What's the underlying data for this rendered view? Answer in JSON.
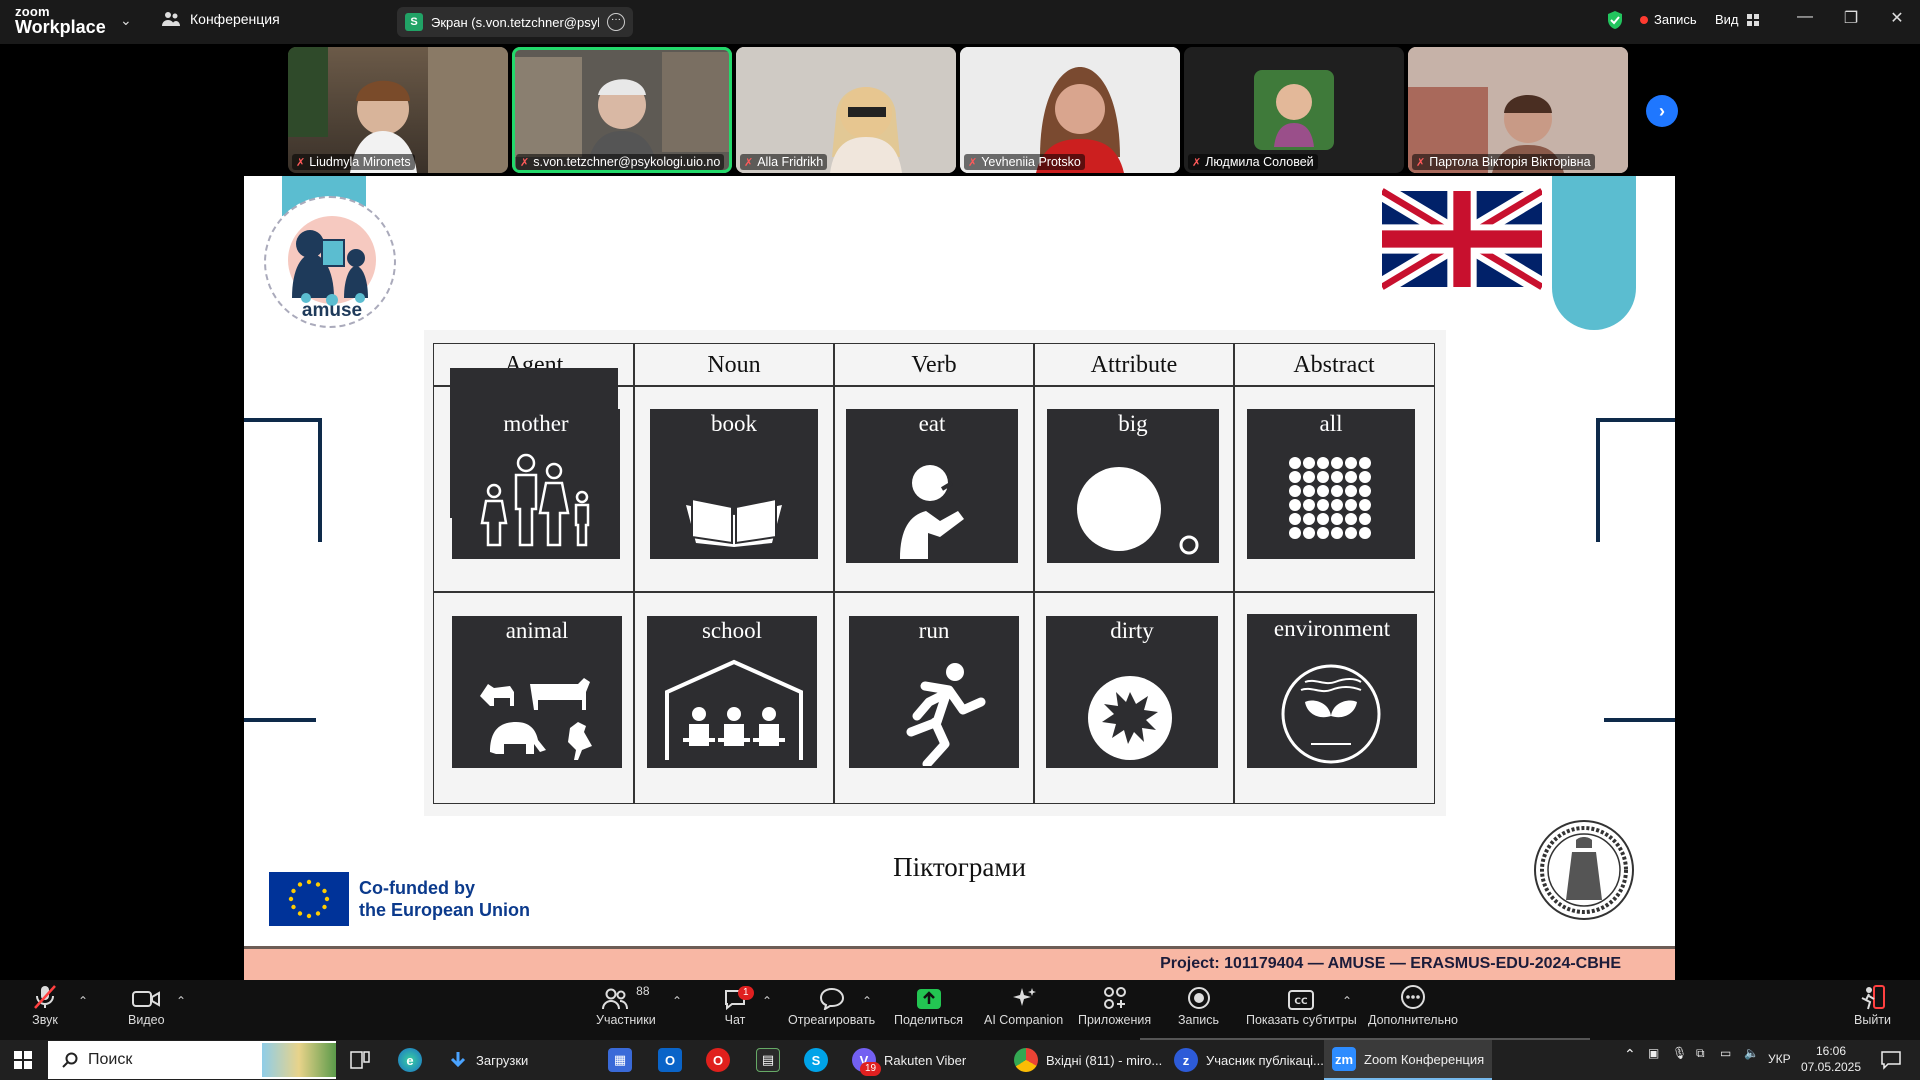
{
  "titlebar": {
    "brand_line1": "zoom",
    "brand_line2": "Workplace",
    "meeting_label": "Конференция",
    "share_badge": "S",
    "share_text": "Экран (s.von.tetzchner@psykolo",
    "record_label": "Запись",
    "view_label": "Вид",
    "colors": {
      "bar": "#1a1a1a",
      "shield": "#22c55e",
      "record": "#ff3b30"
    }
  },
  "participants": [
    {
      "name": "Liudmyla Mironets",
      "active": false
    },
    {
      "name": "s.von.tetzchner@psykologi.uio.no",
      "active": true
    },
    {
      "name": "Alla Fridrikh",
      "active": false
    },
    {
      "name": "Yevheniia Protsko",
      "active": false
    },
    {
      "name": "Людмила Соловей",
      "active": false
    },
    {
      "name": "Партола Вікторія Вікторівна",
      "active": false
    }
  ],
  "slide": {
    "logo_text": "amuse",
    "headers": [
      "Agent",
      "Noun",
      "Verb",
      "Attribute",
      "Abstract"
    ],
    "row1": [
      "mother",
      "book",
      "eat",
      "big",
      "all"
    ],
    "row2": [
      "animal",
      "school",
      "run",
      "dirty",
      "environment"
    ],
    "caption": "Піктограми",
    "eu_line1": "Co-funded by",
    "eu_line2": "the European Union",
    "project": "Project: 101179404 — AMUSE — ERASMUS-EDU-2024-CBHE",
    "colors": {
      "accent": "#5bbdd0",
      "navy": "#0e2a4a",
      "project_bar": "#f8b7a4",
      "eu_blue": "#003399"
    }
  },
  "toolbar": {
    "audio": "Звук",
    "video": "Видео",
    "participants": "Участники",
    "participants_count": "88",
    "chat": "Чат",
    "chat_badge": "1",
    "react": "Отреагировать",
    "share": "Поделиться",
    "ai": "AI Companion",
    "apps": "Приложения",
    "record": "Запись",
    "captions": "Показать субтитры",
    "more": "Дополнительно",
    "leave": "Выйти"
  },
  "taskbar": {
    "search": "Поиск",
    "downloads": "Загрузки",
    "viber": "Rakuten Viber",
    "viber_badge": "19",
    "chrome": "Вхідні (811) - miro...",
    "zoom_public": "Учасник публікаці...",
    "zoom_conf": "Zoom Конференция",
    "lang": "УКР",
    "time": "16:06",
    "date": "07.05.2025"
  }
}
